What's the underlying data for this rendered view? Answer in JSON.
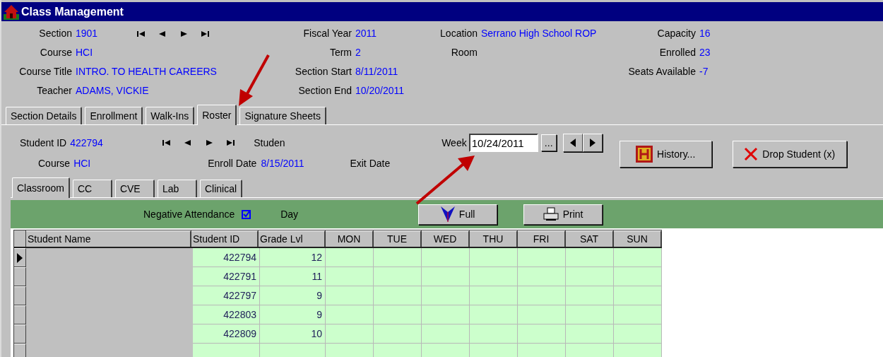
{
  "window": {
    "title": "Class Management"
  },
  "header": {
    "columns": [
      [
        {
          "label": "Section",
          "value": "1901",
          "nav": true
        },
        {
          "label": "Course",
          "value": "HCI"
        },
        {
          "label": "Course Title",
          "value": "INTRO. TO HEALTH CAREERS"
        },
        {
          "label": "Teacher",
          "value": "ADAMS, VICKIE"
        }
      ],
      [
        {
          "label": "Fiscal Year",
          "value": "2011"
        },
        {
          "label": "Term",
          "value": "2"
        },
        {
          "label": "Section Start",
          "value": "8/11/2011"
        },
        {
          "label": "Section End",
          "value": "10/20/2011"
        }
      ],
      [
        {
          "label": "Location",
          "value": "Serrano High School ROP"
        },
        {
          "label": "Room"
        }
      ],
      [
        {
          "label": "Capacity",
          "value": "16"
        },
        {
          "label": "Enrolled",
          "value": "23"
        },
        {
          "label": "Seats Available",
          "value": "-7"
        }
      ]
    ]
  },
  "tabs": [
    {
      "label": "Section Details",
      "selected": false
    },
    {
      "label": "Enrollment",
      "selected": false
    },
    {
      "label": "Walk-Ins",
      "selected": false
    },
    {
      "label": "Roster",
      "selected": true
    },
    {
      "label": "Signature Sheets",
      "selected": false
    }
  ],
  "student": {
    "id_label": "Student ID",
    "id": "422794",
    "name_label": "Studen",
    "course_label": "Course",
    "course": "HCI",
    "enroll_label": "Enroll Date",
    "enroll_date": "8/15/2011",
    "exit_label": "Exit Date",
    "week_label": "Week",
    "week": "10/24/2011",
    "browse": "...",
    "history": "History...",
    "drop": "Drop Student (x)"
  },
  "subtabs": [
    {
      "label": "Classroom",
      "selected": true
    },
    {
      "label": "CC",
      "selected": false
    },
    {
      "label": "CVE",
      "selected": false
    },
    {
      "label": "Lab",
      "selected": false
    },
    {
      "label": "Clinical",
      "selected": false
    }
  ],
  "toolbar": {
    "negative_attendance": "Negative Attendance",
    "checked": true,
    "day": "Day",
    "full": "Full",
    "print": "Print"
  },
  "table": {
    "columns": [
      "Student Name",
      "Student ID",
      "Grade Lvl",
      "MON",
      "TUE",
      "WED",
      "THU",
      "FRI",
      "SAT",
      "SUN"
    ],
    "rows": [
      {
        "selected": true,
        "student_id": "422794",
        "grade": "12"
      },
      {
        "selected": false,
        "student_id": "422791",
        "grade": "11"
      },
      {
        "selected": false,
        "student_id": "422797",
        "grade": "9"
      },
      {
        "selected": false,
        "student_id": "422803",
        "grade": "9"
      },
      {
        "selected": false,
        "student_id": "422809",
        "grade": "10"
      }
    ]
  },
  "annotations": [
    {
      "kind": "arrow"
    },
    {
      "kind": "arrow"
    }
  ]
}
